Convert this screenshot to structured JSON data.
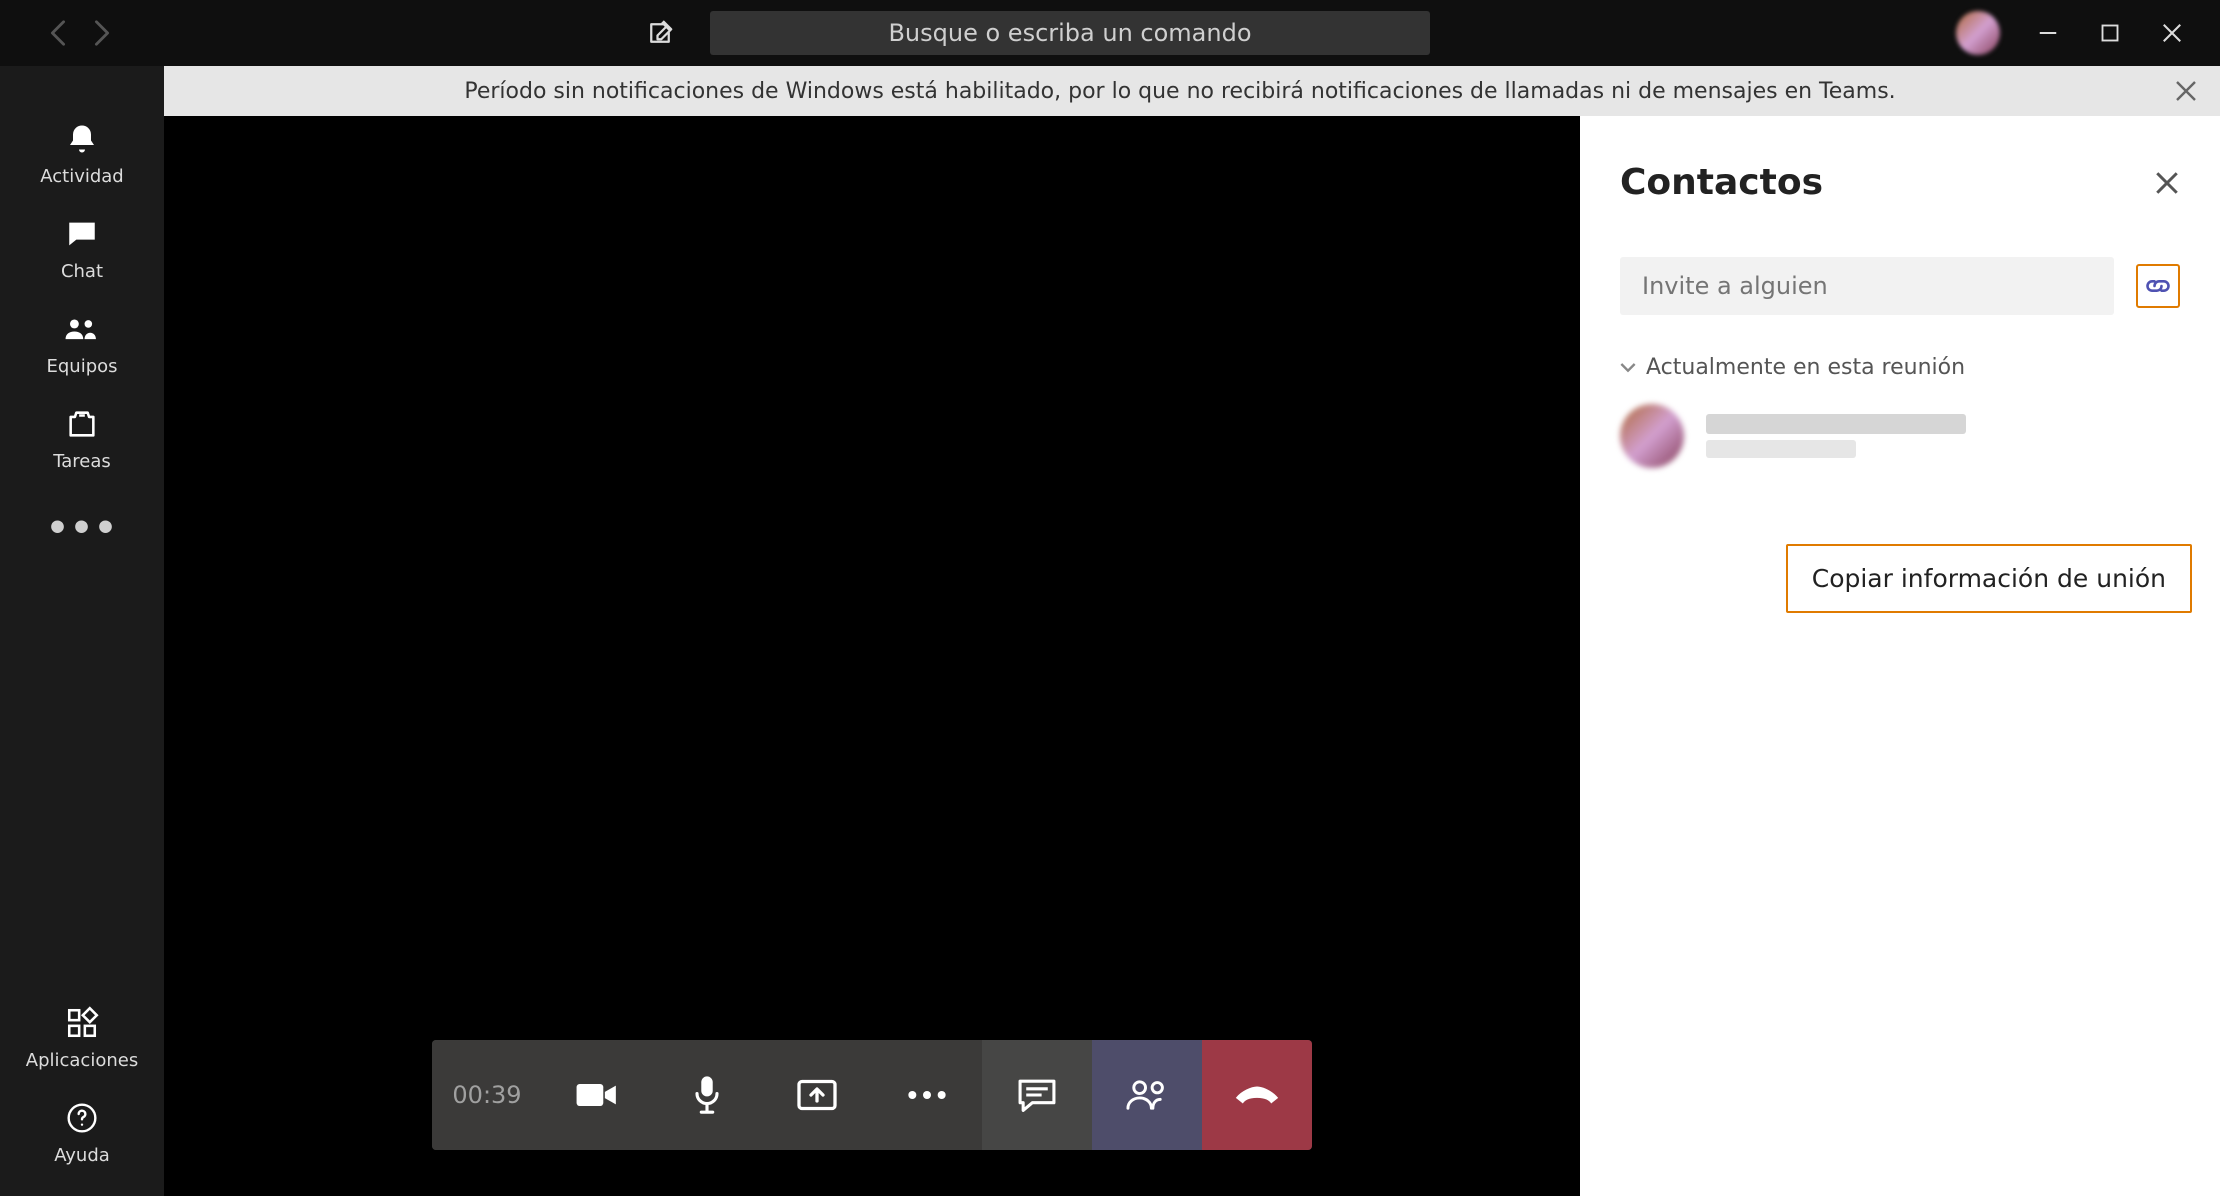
{
  "titlebar": {
    "search_placeholder": "Busque o escriba un comando"
  },
  "rail": {
    "activity": "Actividad",
    "chat": "Chat",
    "teams": "Equipos",
    "tasks": "Tareas",
    "more": "•••",
    "apps": "Aplicaciones",
    "help": "Ayuda"
  },
  "banner": {
    "text": "Período sin notificaciones de Windows está habilitado, por lo que no recibirá notificaciones de llamadas ni de mensajes en Teams."
  },
  "call": {
    "timer": "00:39"
  },
  "panel": {
    "title": "Contactos",
    "invite_placeholder": "Invite a alguien",
    "section": "Actualmente en esta reunión",
    "tooltip": "Copiar información de unión"
  }
}
